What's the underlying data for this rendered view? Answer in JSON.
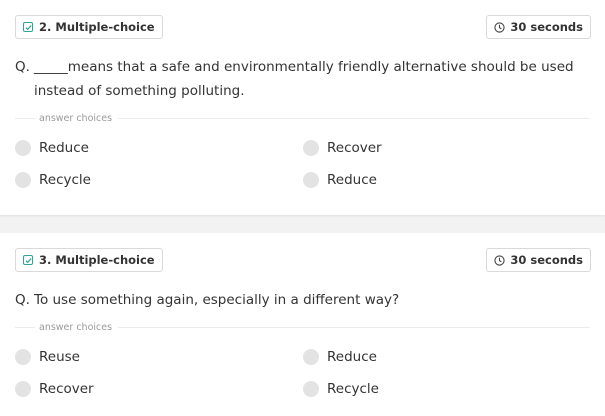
{
  "questions": [
    {
      "type_label": "2. Multiple-choice",
      "time_label": "30 seconds",
      "prefix": "Q.",
      "text": "_____means that a safe and environmentally friendly alternative should be used instead of something polluting.",
      "choices_label": "answer choices",
      "choices": [
        "Reduce",
        "Recover",
        "Recycle",
        "Reduce"
      ]
    },
    {
      "type_label": "3. Multiple-choice",
      "time_label": "30 seconds",
      "prefix": "Q.",
      "text": "To use something again, especially in a different way?",
      "choices_label": "answer choices",
      "choices": [
        "Reuse",
        "Reduce",
        "Recover",
        "Recycle"
      ]
    }
  ],
  "colors": {
    "accent": "#2ea39a",
    "radio": "#e3e3e3",
    "background": "#f2f2f2"
  },
  "icons": {
    "type": "checkbox-icon",
    "time": "clock-icon"
  }
}
